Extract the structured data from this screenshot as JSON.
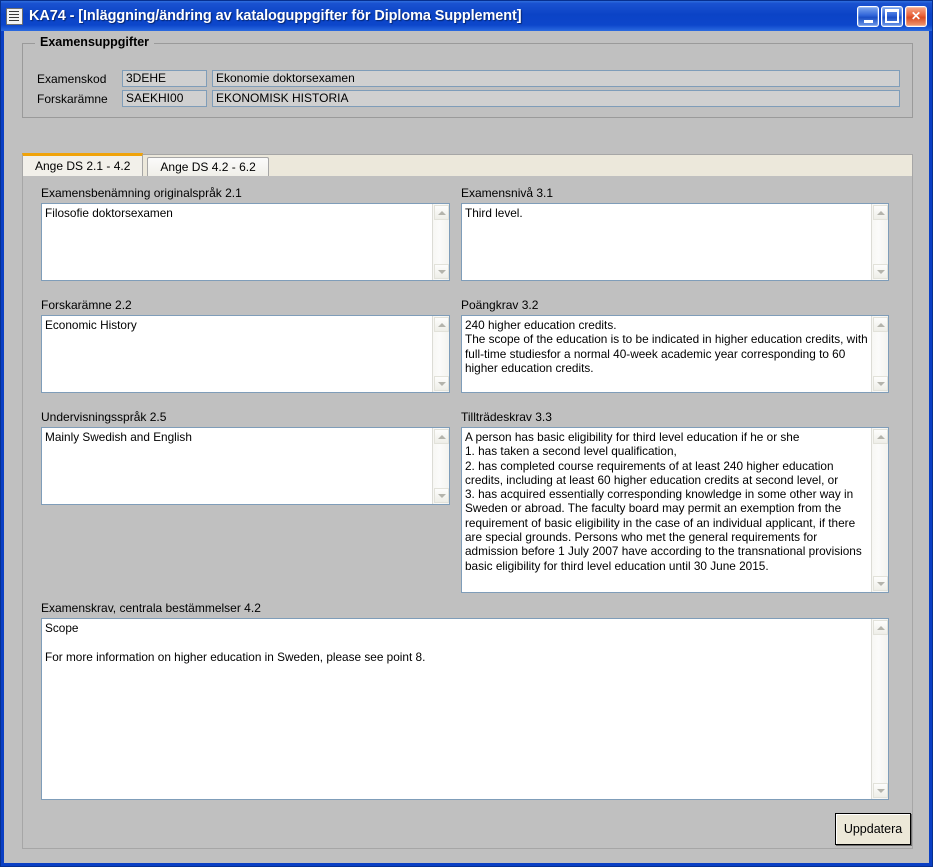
{
  "window": {
    "title": "KA74 - [Inläggning/ändring av kataloguppgifter för Diploma Supplement]",
    "icon": "document-form-icon",
    "minimize_label": "",
    "maximize_label": "",
    "close_label": "✕",
    "accent_titlebar": "#0b43c6",
    "accent_tab": "#f0a30a"
  },
  "groupbox": {
    "title": "Examensuppgifter",
    "rows": [
      {
        "label": "Examenskod",
        "code": "3DEHE",
        "name": "Ekonomie doktorsexamen"
      },
      {
        "label": "Forskarämne",
        "code": "SAEKHI00",
        "name": "EKONOMISK HISTORIA"
      }
    ]
  },
  "tabs": [
    {
      "label": "Ange DS 2.1 - 4.2",
      "active": true
    },
    {
      "label": "Ange DS 4.2 - 6.2",
      "active": false
    }
  ],
  "fields": {
    "examensbenamning": {
      "label": "Examensbenämning originalspråk  2.1",
      "value": "Filosofie doktorsexamen"
    },
    "examensniva": {
      "label": "Examensnivå  3.1",
      "value": "Third level."
    },
    "forskaramne": {
      "label": "Forskarämne  2.2",
      "value": "Economic History"
    },
    "poangkrav": {
      "label": "Poängkrav  3.2",
      "value": "240 higher education credits.\nThe scope of the education is to be indicated in higher education credits, with full-time studiesfor a normal 40-week academic year corresponding to 60 higher education credits."
    },
    "undervisningssprak": {
      "label": "Undervisningsspråk  2.5",
      "value": "Mainly Swedish and English"
    },
    "tilltradeskrav": {
      "label": "Tillträdeskrav  3.3",
      "value": "A person has basic eligibility for third level education if he or she\n1. has taken a second level qualification,\n2. has completed course requirements of at least 240 higher education credits, including at least 60 higher education credits at second level, or\n3. has acquired essentially corresponding knowledge in some other way in Sweden or abroad. The faculty board may permit an exemption from the requirement of basic eligibility in the case of an individual applicant, if there are special grounds. Persons who met the general requirements for admission before 1 July 2007 have according to the transnational provisions basic eligibility for third level education until 30 June 2015."
    },
    "examenskrav": {
      "label": "Examenskrav, centrala bestämmelser  4.2",
      "value": "Scope\n\nFor more information on higher education in Sweden, please see point 8."
    }
  },
  "footer": {
    "update_label": "Uppdatera"
  },
  "scrollbar": {
    "up_icon": "chevron-up-icon",
    "down_icon": "chevron-down-icon"
  }
}
